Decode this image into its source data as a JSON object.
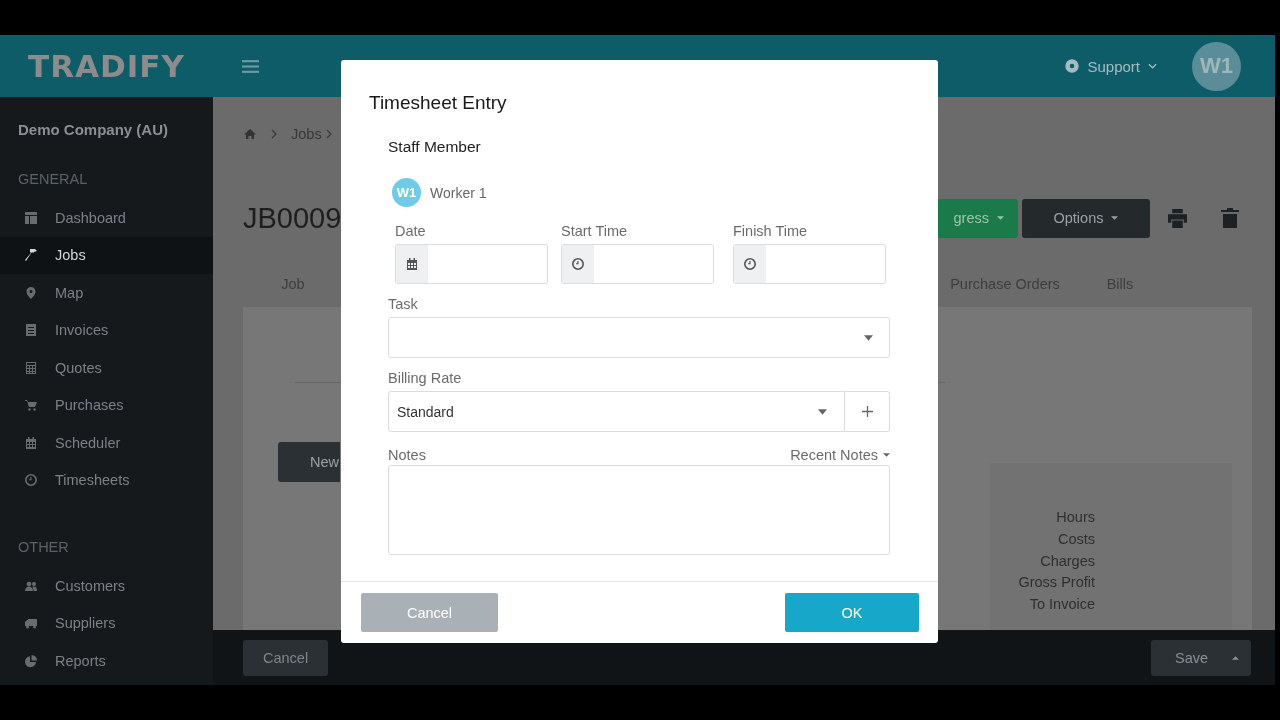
{
  "header": {
    "logo": "TRADIFY",
    "support": "Support",
    "avatar": "W1"
  },
  "sidebar": {
    "company": "Demo Company (AU)",
    "sections": [
      {
        "heading": "GENERAL",
        "items": [
          {
            "label": "Dashboard",
            "kind": "dashboard",
            "selected": false
          },
          {
            "label": "Jobs",
            "kind": "hammer",
            "selected": true
          },
          {
            "label": "Map",
            "kind": "pin",
            "selected": false
          },
          {
            "label": "Invoices",
            "kind": "document",
            "selected": false
          },
          {
            "label": "Quotes",
            "kind": "calculator",
            "selected": false
          },
          {
            "label": "Purchases",
            "kind": "cart",
            "selected": false
          },
          {
            "label": "Scheduler",
            "kind": "calendar",
            "selected": false
          },
          {
            "label": "Timesheets",
            "kind": "clock",
            "selected": false
          }
        ]
      },
      {
        "heading": "OTHER",
        "items": [
          {
            "label": "Customers",
            "kind": "people",
            "selected": false
          },
          {
            "label": "Suppliers",
            "kind": "truck",
            "selected": false
          },
          {
            "label": "Reports",
            "kind": "pie",
            "selected": false
          }
        ]
      }
    ]
  },
  "page": {
    "breadcrumb": "Jobs",
    "title": "JB0009",
    "status_button": "gress",
    "options_button": "Options",
    "tabs": [
      "Job",
      "Purchase Orders",
      "Bills"
    ],
    "new_button": "New",
    "summary": [
      "Hours",
      "Costs",
      "Charges",
      "Gross Profit",
      "To Invoice"
    ],
    "footer": {
      "cancel": "Cancel",
      "save": "Save"
    }
  },
  "dialog": {
    "title": "Timesheet Entry",
    "staff_label": "Staff Member",
    "staff": {
      "initials": "W1",
      "name": "Worker 1"
    },
    "time_fields": [
      {
        "label": "Date",
        "kind": "calendar"
      },
      {
        "label": "Start Time",
        "kind": "clock"
      },
      {
        "label": "Finish Time",
        "kind": "clock"
      }
    ],
    "task": {
      "label": "Task"
    },
    "billing_rate": {
      "label": "Billing Rate",
      "value": "Standard"
    },
    "notes": {
      "label": "Notes",
      "recent": "Recent Notes"
    },
    "buttons": {
      "cancel": "Cancel",
      "ok": "OK"
    }
  }
}
